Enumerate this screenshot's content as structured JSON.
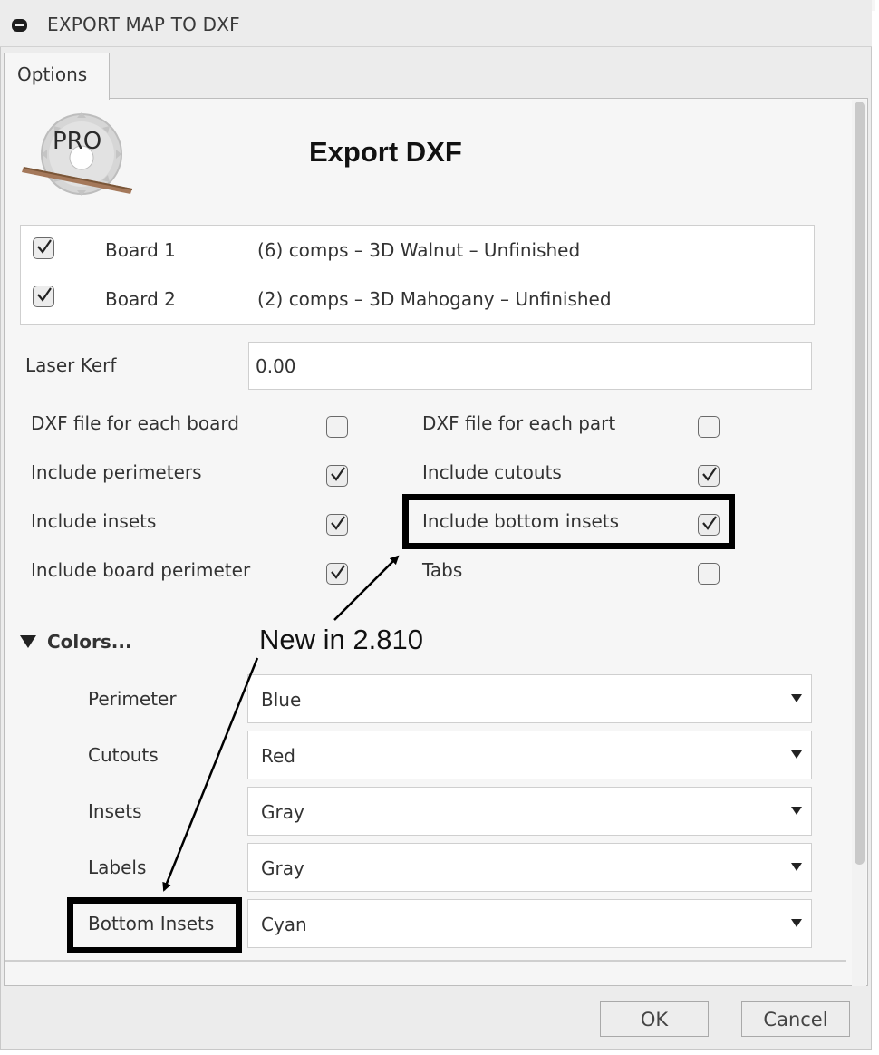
{
  "window": {
    "title": "EXPORT MAP TO DXF"
  },
  "tabs": [
    {
      "label": "Options",
      "active": true
    }
  ],
  "logo": {
    "text": "PRO",
    "icon": "saw-blade-pro-logo"
  },
  "header": {
    "title": "Export DXF"
  },
  "boards": [
    {
      "checked": true,
      "name": "Board 1",
      "description": "(6) comps – 3D Walnut – Unfinished"
    },
    {
      "checked": true,
      "name": "Board 2",
      "description": "(2) comps – 3D Mahogany – Unfinished"
    }
  ],
  "kerf": {
    "label": "Laser Kerf",
    "value": "0.00"
  },
  "options": {
    "dxf_each_board": {
      "label": "DXF file for each board",
      "checked": false
    },
    "dxf_each_part": {
      "label": "DXF file for each part",
      "checked": false
    },
    "include_perimeters": {
      "label": "Include perimeters",
      "checked": true
    },
    "include_cutouts": {
      "label": "Include cutouts",
      "checked": true
    },
    "include_insets": {
      "label": "Include insets",
      "checked": true
    },
    "include_bottom_insets": {
      "label": "Include bottom insets",
      "checked": true
    },
    "include_board_perimeter": {
      "label": "Include board perimeter",
      "checked": true
    },
    "tabs": {
      "label": "Tabs",
      "checked": false
    }
  },
  "colors": {
    "label": "Colors...",
    "expanded": true,
    "rows": [
      {
        "label": "Perimeter",
        "value": "Blue"
      },
      {
        "label": "Cutouts",
        "value": "Red"
      },
      {
        "label": "Insets",
        "value": "Gray"
      },
      {
        "label": "Labels",
        "value": "Gray"
      },
      {
        "label": "Bottom Insets",
        "value": "Cyan"
      }
    ]
  },
  "annotation": {
    "text": "New in 2.810"
  },
  "buttons": {
    "ok": "OK",
    "cancel": "Cancel"
  },
  "theme": {
    "window_bg": "#ececec",
    "panel_bg": "#f6f6f6",
    "annotation": "#000000"
  }
}
